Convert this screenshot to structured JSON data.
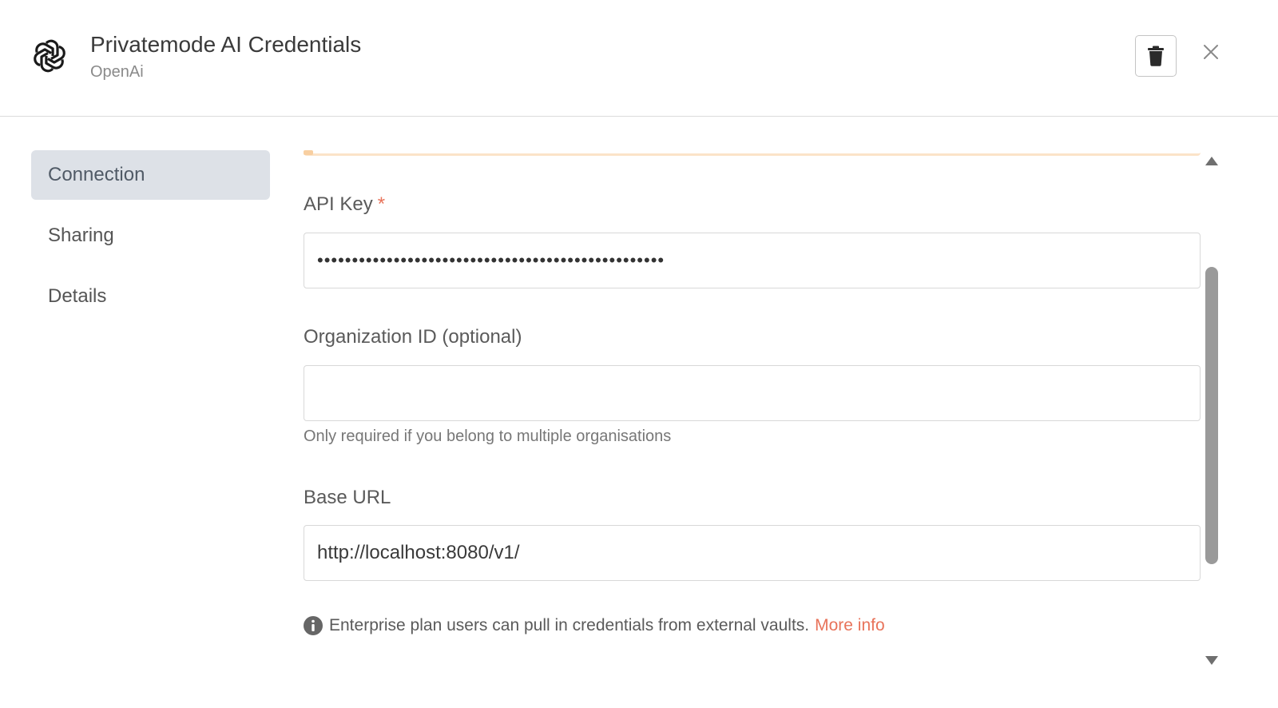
{
  "header": {
    "title": "Privatemode AI Credentials",
    "subtitle": "OpenAi",
    "logo_icon": "openai-logo-icon",
    "delete_icon": "trash-icon",
    "close_icon": "close-icon"
  },
  "sidebar": {
    "items": [
      {
        "label": "Connection",
        "active": true
      },
      {
        "label": "Sharing",
        "active": false
      },
      {
        "label": "Details",
        "active": false
      }
    ]
  },
  "form": {
    "api_key": {
      "label": "API Key",
      "required_marker": "*",
      "value": "••••••••••••••••••••••••••••••••••••••••••••••••••"
    },
    "organization_id": {
      "label": "Organization ID (optional)",
      "value": "",
      "hint": "Only required if you belong to multiple organisations"
    },
    "base_url": {
      "label": "Base URL",
      "value": "http://localhost:8080/v1/"
    },
    "info": {
      "icon": "info-icon",
      "text": "Enterprise plan users can pull in credentials from external vaults.",
      "link": "More info"
    }
  },
  "colors": {
    "accent": "#e8735a",
    "active_nav_bg": "#dde1e7",
    "warning_line": "#fbe3c8"
  }
}
